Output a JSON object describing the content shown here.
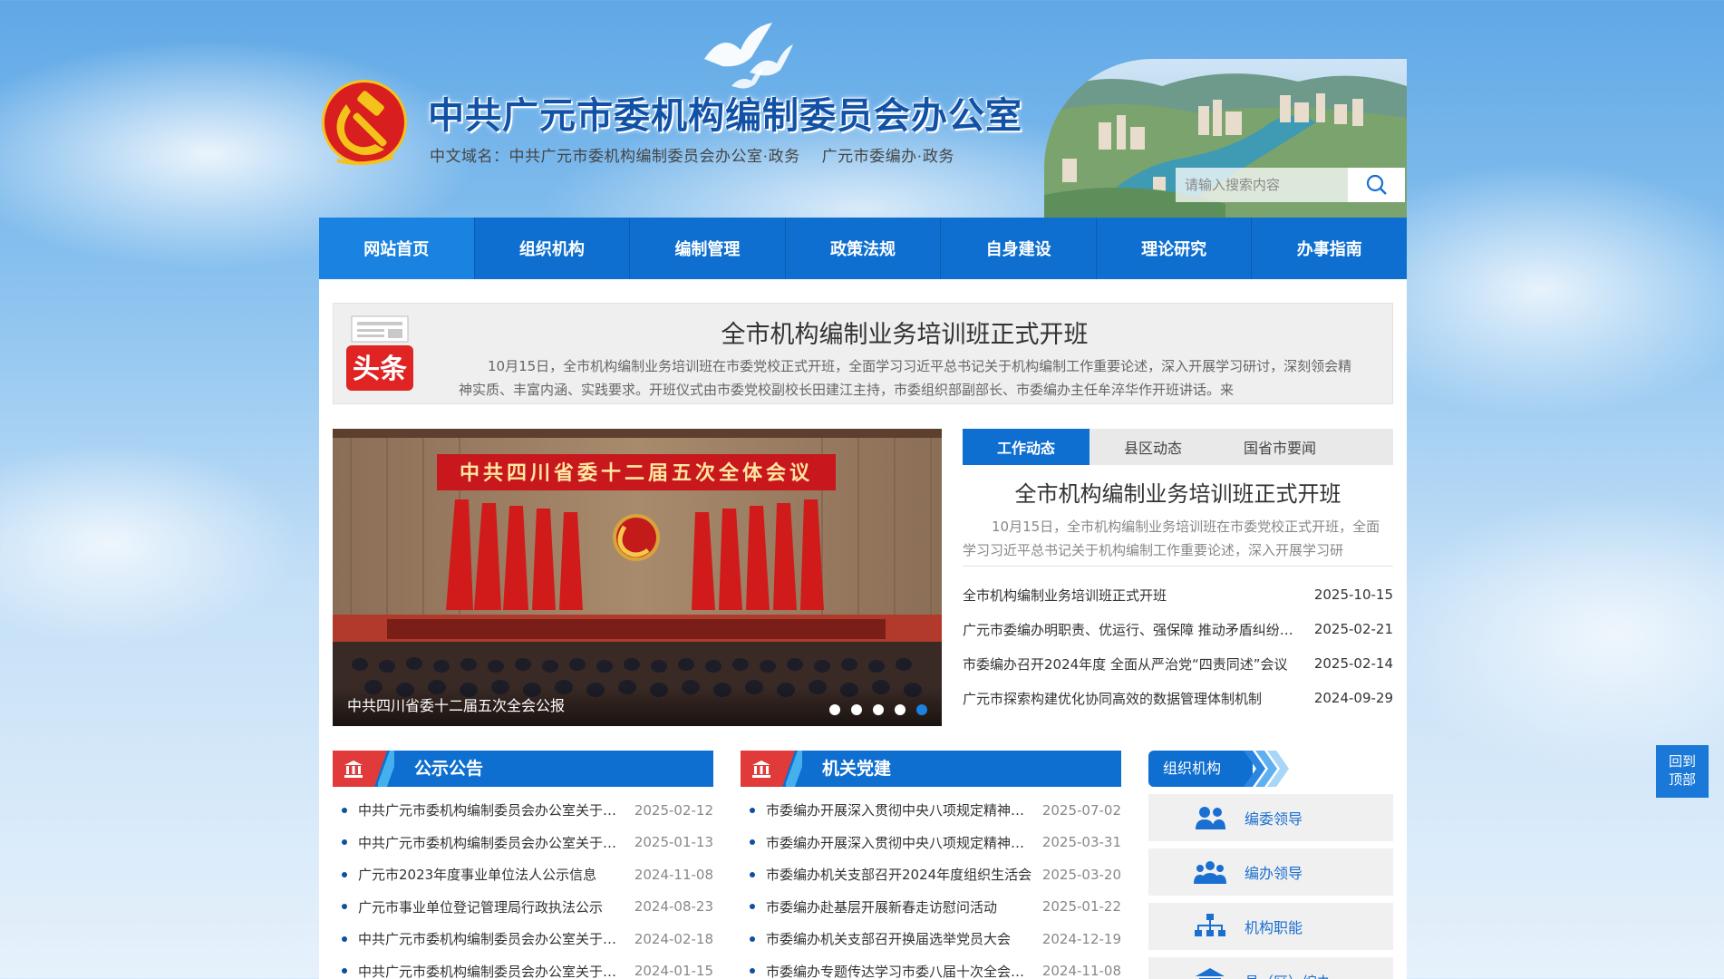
{
  "header": {
    "site_title": "中共广元市委机构编制委员会办公室",
    "domain_label": "中文域名：中共广元市委机构编制委员会办公室·政务",
    "domain_alt": "广元市委编办·政务",
    "search_placeholder": "请输入搜索内容",
    "icons": {
      "emblem": "party-emblem-icon",
      "search": "search-icon"
    }
  },
  "nav": {
    "items": [
      {
        "label": "网站首页",
        "active": true
      },
      {
        "label": "组织机构"
      },
      {
        "label": "编制管理"
      },
      {
        "label": "政策法规"
      },
      {
        "label": "自身建设"
      },
      {
        "label": "理论研究"
      },
      {
        "label": "办事指南"
      }
    ]
  },
  "headline": {
    "badge": "头条",
    "title": "全市机构编制业务培训班正式开班",
    "summary": "10月15日，全市机构编制业务培训班在市委党校正式开班，全面学习习近平总书记关于机构编制工作重要论述，深入开展学习研讨，深刻领会精神实质、丰富内涵、实践要求。开班仪式由市委党校副校长田建江主持，市委组织部副部长、市委编办主任牟淬华作开班讲话。来"
  },
  "carousel": {
    "banner_text": "中共四川省委十二届五次全体会议",
    "caption": "中共四川省委十二届五次全会公报",
    "dot_count": 5,
    "active_dot": 4
  },
  "news": {
    "tabs": [
      "工作动态",
      "县区动态",
      "国省市要闻"
    ],
    "active_tab": 0,
    "feature_title": "全市机构编制业务培训班正式开班",
    "feature_summary": "10月15日，全市机构编制业务培训班在市委党校正式开班，全面学习习近平总书记关于机构编制工作重要论述，深入开展学习研",
    "items": [
      {
        "title": "全市机构编制业务培训班正式开班",
        "date": "2025-10-15"
      },
      {
        "title": "广元市委编办明职责、优运行、强保障 推动矛盾纠纷多元化解",
        "date": "2025-02-21"
      },
      {
        "title": "市委编办召开2024年度 全面从严治党“四责同述”会议",
        "date": "2025-02-14"
      },
      {
        "title": "广元市探索构建优化协同高效的数据管理体制机制",
        "date": "2024-09-29"
      }
    ]
  },
  "notice": {
    "title": "公示公告",
    "items": [
      {
        "title": "中共广元市委机构编制委员会办公室关于公示的公告",
        "date": "2025-02-12"
      },
      {
        "title": "中共广元市委机构编制委员会办公室关于公示的公告",
        "date": "2025-01-13"
      },
      {
        "title": "广元市2023年度事业单位法人公示信息",
        "date": "2024-11-08"
      },
      {
        "title": "广元市事业单位登记管理局行政执法公示",
        "date": "2024-08-23"
      },
      {
        "title": "中共广元市委机构编制委员会办公室关于公示的公告",
        "date": "2024-02-18"
      },
      {
        "title": "中共广元市委机构编制委员会办公室关于公示的公告",
        "date": "2024-01-15"
      }
    ]
  },
  "party": {
    "title": "机关党建",
    "items": [
      {
        "title": "市委编办开展深入贯彻中央八项规定精神学习教育",
        "date": "2025-07-02"
      },
      {
        "title": "市委编办开展深入贯彻中央八项规定精神学习教育",
        "date": "2025-03-31"
      },
      {
        "title": "市委编办机关支部召开2024年度组织生活会",
        "date": "2025-03-20"
      },
      {
        "title": "市委编办赴基层开展新春走访慰问活动",
        "date": "2025-01-22"
      },
      {
        "title": "市委编办机关支部召开换届选举党员大会",
        "date": "2024-12-19"
      },
      {
        "title": "市委编办专题传达学习市委八届十次全会精神",
        "date": "2024-11-08"
      }
    ]
  },
  "org": {
    "title": "组织机构",
    "items": [
      {
        "label": "编委领导",
        "icon": "leaders-icon"
      },
      {
        "label": "编办领导",
        "icon": "team-icon"
      },
      {
        "label": "机构职能",
        "icon": "org-chart-icon"
      },
      {
        "label": "县（区）编办",
        "icon": "building-icon"
      }
    ]
  },
  "back_to_top": {
    "line1": "回到",
    "line2": "顶部"
  },
  "colors": {
    "primary": "#0e6fd0",
    "accent_red": "#e03a3a",
    "title_blue": "#1252a6"
  }
}
